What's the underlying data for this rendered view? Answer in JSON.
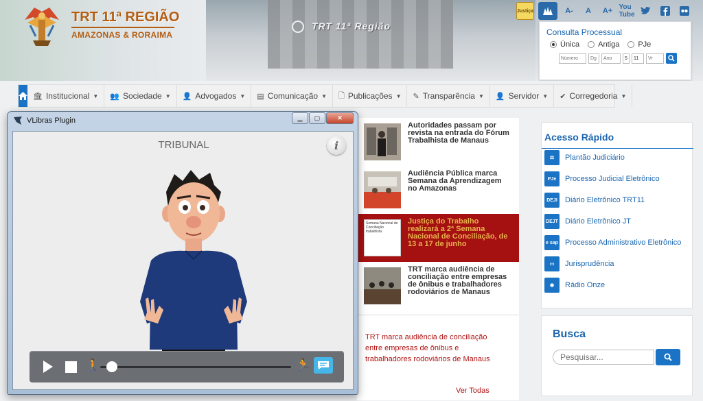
{
  "brand": {
    "title": "TRT 11ª REGIÃO",
    "subtitle": "AMAZONAS & RORAIMA",
    "building_sign": "TRT 11ª Região"
  },
  "accessibility": {
    "justica_badge": "Justiça",
    "font_decrease": "A-",
    "font_normal": "A",
    "font_increase": "A+",
    "tv": "You Tube"
  },
  "consulta": {
    "title": "Consulta Processual",
    "options": [
      "Única",
      "Antiga",
      "PJe"
    ],
    "selected": "Única",
    "fields": {
      "numero": "Número",
      "dg": "Dg",
      "ano": "Ano",
      "j": "5",
      "tr": "11",
      "vr": "Vr"
    }
  },
  "nav": {
    "items": [
      "Institucional",
      "Sociedade",
      "Advogados",
      "Comunicação",
      "Publicações",
      "Transparência",
      "Servidor",
      "Corregedoria"
    ]
  },
  "news": {
    "items": [
      {
        "text": "Autoridades passam por revista na entrada do Fórum Trabalhista de Manaus"
      },
      {
        "text": "Audiência Pública marca Semana da Aprendizagem no Amazonas"
      },
      {
        "text": "Justiça do Trabalho realizará a 2ª Semana Nacional de Conciliação, de 13 a 17 de junho"
      },
      {
        "text": "TRT marca audiência de conciliação entre empresas de ônibus e trabalhadores rodoviários de Manaus"
      }
    ],
    "thumb3_caption": "Semana Nacional de Conciliação trabalhista",
    "feature": "TRT marca audiência de conciliação entre empresas de ônibus e trabalhadores rodoviários de Manaus",
    "ver_todas": "Ver Todas"
  },
  "acesso_rapido": {
    "title": "Acesso Rápido",
    "items": [
      {
        "label": "Plantão Judiciário",
        "icon": "gavel-icon"
      },
      {
        "label": "Processo Judicial Eletrônico",
        "icon": "pje-icon"
      },
      {
        "label": "Diário Eletrônico TRT11",
        "icon": "deji-icon"
      },
      {
        "label": "Diário Eletrônico JT",
        "icon": "dejt-icon"
      },
      {
        "label": "Processo Administrativo Eletrônico",
        "icon": "sap-icon"
      },
      {
        "label": "Jurisprudência",
        "icon": "monitor-icon"
      },
      {
        "label": "Rádio Onze",
        "icon": "radio-icon"
      }
    ]
  },
  "busca": {
    "title": "Busca",
    "placeholder": "Pesquisar..."
  },
  "vlibras": {
    "window_title": "VLibras Plugin",
    "word": "TRIBUNAL",
    "progress": 0.06,
    "colors": {
      "subtitle_button": "#46b6e8",
      "player_bar": "#6b6e72"
    }
  },
  "colors": {
    "primary": "#1a73c4",
    "brand": "#b35d12",
    "news_active": "#a51010",
    "news_link": "#b11414"
  }
}
